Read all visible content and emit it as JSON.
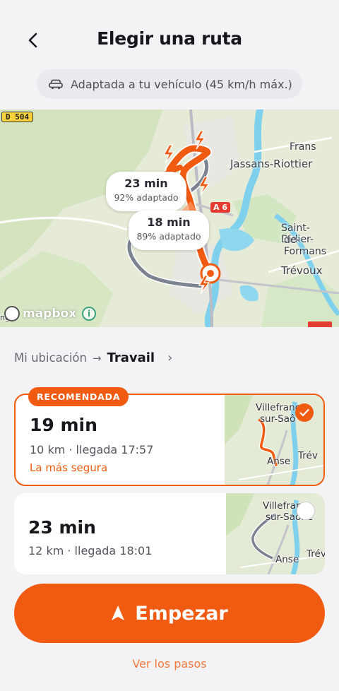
{
  "header": {
    "title": "Elegir una ruta"
  },
  "vehicle": {
    "label": "Adaptada a tu vehículo (45 km/h máx.)"
  },
  "map": {
    "road_badge": "D 504",
    "a6_badge": "A 6",
    "places": [
      "Frans",
      "Jassans-Riottier",
      "Saint-Didier-",
      "de-Formans",
      "Trévoux"
    ],
    "bubbles": [
      {
        "time": "23 min",
        "adapted": "92% adaptado"
      },
      {
        "time": "18 min",
        "adapted": "89% adaptado"
      }
    ],
    "attribution": "mapbox",
    "edge_text": "ng"
  },
  "breadcrumb": {
    "from": "Mi ubicación",
    "arrow": "→",
    "to": "Travail"
  },
  "routes": [
    {
      "badge": "RECOMENDADA",
      "time": "19 min",
      "info": "10 km · llegada 17:57",
      "tag": "La más segura",
      "thumb_labels": [
        "Villefranc",
        "sur-Saô",
        "Anse",
        "Trév"
      ],
      "selected": true
    },
    {
      "time": "23 min",
      "info": "12 km · llegada 18:01",
      "thumb_labels": [
        "Villefranc",
        "sur-Saône",
        "Anse",
        "Trév"
      ],
      "selected": false
    }
  ],
  "actions": {
    "start": "Empezar",
    "steps": "Ver los pasos"
  },
  "colors": {
    "accent": "#f15a11",
    "route_alt": "#7b8391",
    "water": "#7fd0ec",
    "park": "#d5e7c0"
  }
}
